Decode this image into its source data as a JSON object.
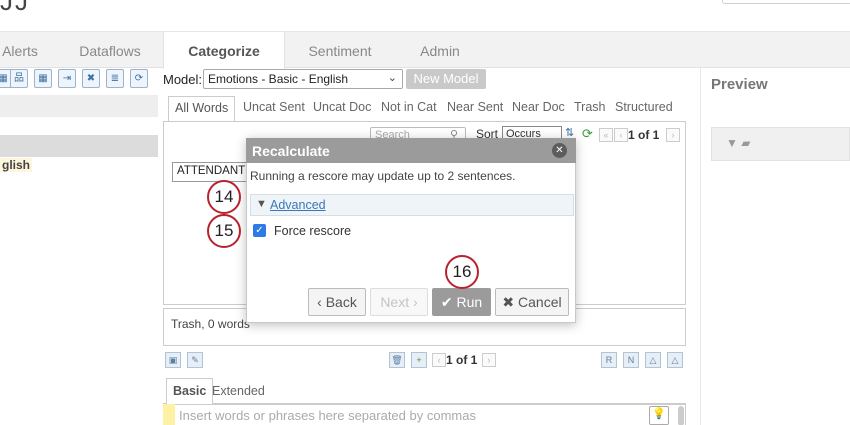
{
  "header": {
    "logo_fragment": "JJ"
  },
  "tabs": [
    {
      "label": "Alerts"
    },
    {
      "label": "Dataflows"
    },
    {
      "label": "Categorize"
    },
    {
      "label": "Sentiment"
    },
    {
      "label": "Admin"
    }
  ],
  "left_panel": {
    "selected_text": "glish"
  },
  "model": {
    "label": "Model:",
    "selected": "Emotions - Basic - English",
    "new_model_label": "New Model"
  },
  "subtabs": [
    {
      "label": "All Words"
    },
    {
      "label": "Uncat Sent"
    },
    {
      "label": "Uncat Doc"
    },
    {
      "label": "Not in Cat"
    },
    {
      "label": "Near Sent"
    },
    {
      "label": "Near Doc"
    },
    {
      "label": "Trash"
    },
    {
      "label": "Structured"
    }
  ],
  "words": {
    "search_placeholder": "Search",
    "sort_label": "Sort",
    "sort_value": "Occurs",
    "pager": "1 of 1",
    "first_word": "ATTENDANT"
  },
  "trash": {
    "text": "Trash, 0 words"
  },
  "bottom_pager": "1 of 1",
  "input_tabs": {
    "basic": "Basic",
    "extended": "Extended"
  },
  "insert": {
    "placeholder": "Insert words or phrases here separated by commas"
  },
  "preview": {
    "title": "Preview"
  },
  "modal": {
    "title": "Recalculate",
    "message": "Running a rescore may update up to 2 sentences.",
    "advanced_label": "Advanced",
    "force_label": "Force rescore",
    "force_checked": true,
    "back_label": "Back",
    "next_label": "Next",
    "run_label": "Run",
    "cancel_label": "Cancel"
  },
  "callouts": {
    "c14": "14",
    "c15": "15",
    "c16": "16"
  },
  "colors": {
    "accent_check": "#2f7be6",
    "callout_border": "#b8222f",
    "modal_header": "#9b9b9b",
    "link": "#3b77b8"
  }
}
